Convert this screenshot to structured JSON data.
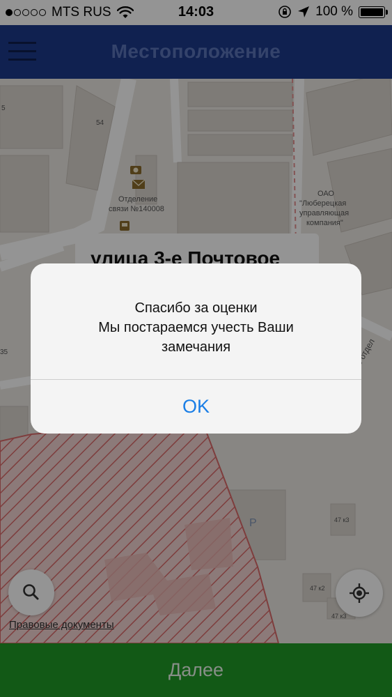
{
  "status_bar": {
    "carrier": "MTS RUS",
    "time": "14:03",
    "battery": "100 %",
    "signal_bars_filled": 1,
    "signal_bars_total": 5,
    "battery_level": 1.0,
    "icons": [
      "signal-dots-icon",
      "wifi-icon",
      "orientation-lock-icon",
      "location-arrow-icon",
      "battery-icon"
    ]
  },
  "nav": {
    "title": "Местоположение",
    "menu_icon": "hamburger-menu-icon"
  },
  "map": {
    "labels": {
      "building_54": "54",
      "post_office_line1": "Отделение",
      "post_office_line2": "связи №140008",
      "company_line1": "ОАО",
      "company_line2": "\"Люберецкая",
      "company_line3": "управляющая",
      "company_line4": "компания\"",
      "left_number": "5",
      "left_number_2": "35",
      "street_fragment": "ое отдел",
      "parking": "P",
      "building_47k3_a": "47 к3",
      "building_47k2": "47 к2",
      "building_47k3_b": "47 к3"
    },
    "street_card": "улица 3-е Почтовое",
    "legal_link": "Правовые документы",
    "icons": [
      "post-office-icon",
      "envelope-icon",
      "bus-stop-icon",
      "search-icon",
      "my-location-icon"
    ]
  },
  "alert": {
    "line1": "Спасибо за оценки",
    "line2": "Мы постараемся учесть Ваши",
    "line3": "замечания",
    "ok": "OK"
  },
  "bottom_button": {
    "label": "Далее"
  },
  "colors": {
    "nav_bg": "#1d3a8a",
    "next_button_bg": "#1f9a26",
    "alert_button_text": "#1a7ee6",
    "hatch_zone": "#d96a6a"
  }
}
